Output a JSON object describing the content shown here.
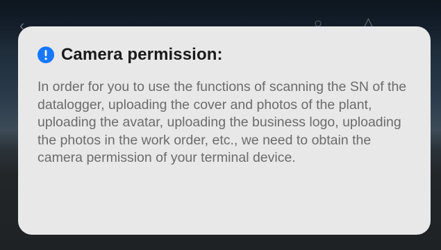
{
  "dialog": {
    "title": "Camera permission:",
    "message": "In order for you to use the functions of scanning the SN of the datalogger, uploading the cover and photos of the plant, uploading the avatar, uploading the business logo, uploading the photos in the work order, etc., we need to obtain the camera permission of your terminal device.",
    "icon": "info-icon"
  },
  "background": {
    "icons": [
      "back-arrow-icon",
      "search-icon",
      "more-icon"
    ]
  },
  "colors": {
    "accent": "#1677ff",
    "dialog_bg": "#e8e8e8",
    "title_text": "#1a1a1a",
    "body_text": "#6b6b6b"
  }
}
